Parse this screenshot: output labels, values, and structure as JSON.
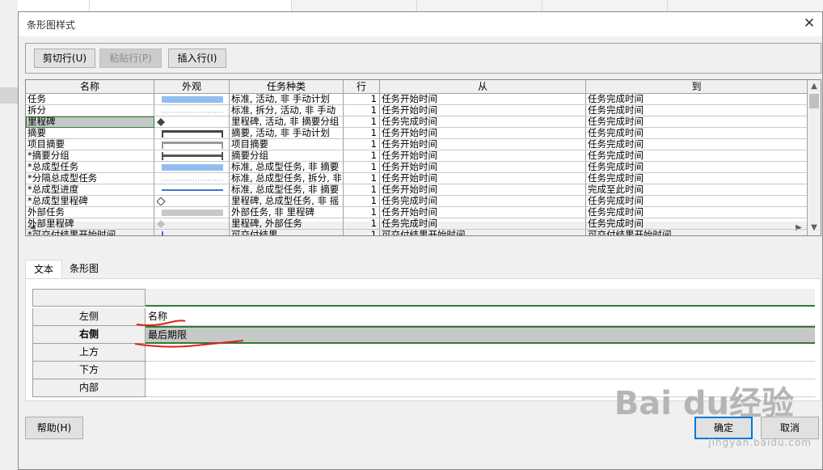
{
  "dialog": {
    "title": "条形图样式",
    "close_glyph": "✕"
  },
  "toolbar": {
    "cut": "剪切行(U)",
    "paste": "粘贴行(P)",
    "insert": "插入行(I)"
  },
  "grid": {
    "columns": [
      "名称",
      "外观",
      "任务种类",
      "行",
      "从",
      "到"
    ],
    "rows": [
      {
        "name": "任务",
        "appearance": "blue-bar",
        "kind": "标准, 活动, 非 手动计划",
        "row": "1",
        "from": "任务开始时间",
        "to": "任务完成时间"
      },
      {
        "name": "拆分",
        "appearance": "dotted",
        "kind": "标准, 拆分, 活动, 非 手动",
        "row": "1",
        "from": "任务开始时间",
        "to": "任务完成时间"
      },
      {
        "name": "里程碑",
        "appearance": "diamond",
        "kind": "里程碑, 活动, 非 摘要分组",
        "row": "1",
        "from": "任务完成时间",
        "to": "任务完成时间"
      },
      {
        "name": "摘要",
        "appearance": "summary-bracket",
        "kind": "摘要, 活动, 非 手动计划",
        "row": "1",
        "from": "任务开始时间",
        "to": "任务完成时间"
      },
      {
        "name": "项目摘要",
        "appearance": "gray-bracket",
        "kind": "项目摘要",
        "row": "1",
        "from": "任务开始时间",
        "to": "任务完成时间"
      },
      {
        "name": "*摘要分组",
        "appearance": "group-bracket",
        "kind": "摘要分组",
        "row": "1",
        "from": "任务开始时间",
        "to": "任务完成时间"
      },
      {
        "name": "*总成型任务",
        "appearance": "blue-bar",
        "kind": "标准, 总成型任务, 非 摘要",
        "row": "1",
        "from": "任务开始时间",
        "to": "任务完成时间"
      },
      {
        "name": "*分隔总成型任务",
        "appearance": "dotted",
        "kind": "标准, 总成型任务, 拆分, 非",
        "row": "1",
        "from": "任务开始时间",
        "to": "任务完成时间"
      },
      {
        "name": "*总成型进度",
        "appearance": "thin-line",
        "kind": "标准, 总成型任务, 非 摘要",
        "row": "1",
        "from": "任务开始时间",
        "to": "完成至此时间"
      },
      {
        "name": "*总成型里程碑",
        "appearance": "hollow-diamond",
        "kind": "里程碑, 总成型任务, 非 摇",
        "row": "1",
        "from": "任务完成时间",
        "to": "任务完成时间"
      },
      {
        "name": "外部任务",
        "appearance": "gray-bar",
        "kind": "外部任务, 非 里程碑",
        "row": "1",
        "from": "任务开始时间",
        "to": "任务完成时间"
      },
      {
        "name": "外部里程碑",
        "appearance": "gray-diamond",
        "kind": "里程碑, 外部任务",
        "row": "1",
        "from": "任务完成时间",
        "to": "任务完成时间"
      },
      {
        "name": "*可交付结果开始时间",
        "appearance": "purple-tick",
        "kind": "可交付结果",
        "row": "1",
        "from": "可交付结果开始时间",
        "to": "可交付结果开始时间"
      }
    ]
  },
  "tabs": [
    "文本",
    "条形图"
  ],
  "labels": {
    "header_value": "",
    "rows": [
      {
        "label": "左侧",
        "value": "名称"
      },
      {
        "label": "右侧",
        "value": "最后期限"
      },
      {
        "label": "上方",
        "value": ""
      },
      {
        "label": "下方",
        "value": ""
      },
      {
        "label": "内部",
        "value": ""
      }
    ]
  },
  "footer": {
    "help": "帮助(H)",
    "ok": "确定",
    "cancel": "取消"
  },
  "watermark": {
    "brand": "Bai du经验",
    "url": "jingyan.baidu.com"
  },
  "colors": {
    "accent_green": "#2f7d32",
    "bar_blue": "#92bdf0",
    "focus_blue": "#0078d7",
    "annotation_red": "#e02020"
  }
}
